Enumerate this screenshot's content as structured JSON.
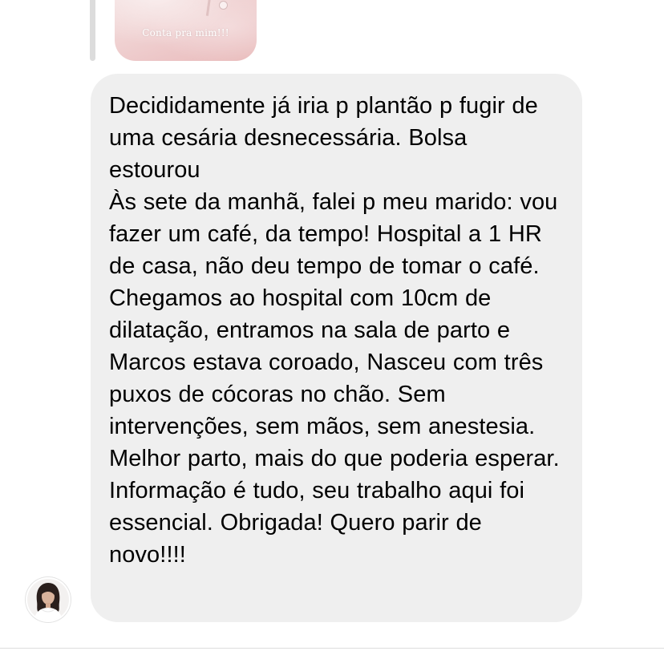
{
  "story_reply": {
    "caption": "Conta pra mim!!!"
  },
  "message": {
    "text": "Decididamente já iria p plantão p fugir de uma cesária desnecessária. Bolsa estourou\nÀs sete da manhã, falei p meu marido: vou fazer um café, da tempo! Hospital a 1 HR de casa, não deu tempo de tomar o café. Chegamos ao hospital com 10cm de dilatação, entramos na sala de parto e Marcos estava coroado, Nasceu com três puxos de cócoras no chão. Sem intervenções, sem mãos, sem anestesia. Melhor parto, mais do que poderia esperar. Informação é tudo, seu trabalho aqui foi essencial. Obrigada! Quero parir de novo!!!!"
  },
  "sender": {
    "avatar_icon": "user-photo-avatar"
  },
  "colors": {
    "bubble_background": "#efefef",
    "text": "#000000",
    "story_tint": "#f1d6d6"
  }
}
